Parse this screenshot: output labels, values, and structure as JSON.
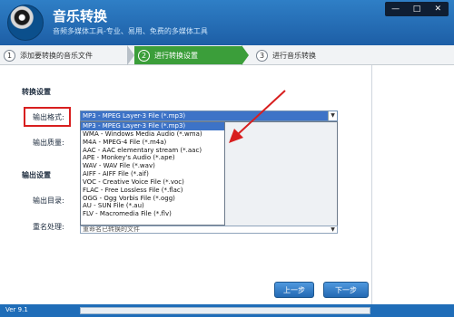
{
  "app": {
    "title": "音乐转换",
    "subtitle": "音频多媒体工具-专业、易用、免费的多媒体工具",
    "window_buttons": [
      "—",
      "□",
      "✕"
    ]
  },
  "steps": [
    {
      "num": "1",
      "label": "添加要转换的音乐文件"
    },
    {
      "num": "2",
      "label": "进行转换设置"
    },
    {
      "num": "3",
      "label": "进行音乐转换"
    }
  ],
  "settings": {
    "conversion_section": "转换设置",
    "format_label": "输出格式:",
    "quality_label": "输出质量:",
    "output_section": "输出设置",
    "dir_label": "输出目录:",
    "rename_label": "重名处理:",
    "rename_value": "重命名已转换的文件"
  },
  "format_select": {
    "selected": "MP3 - MPEG Layer-3 File (*.mp3)",
    "options": [
      "MP3 - MPEG Layer-3 File (*.mp3)",
      "WMA - Windows Media Audio (*.wma)",
      "M4A - MPEG-4 File (*.m4a)",
      "AAC - AAC elementary stream (*.aac)",
      "APE - Monkey's Audio (*.ape)",
      "WAV - WAV File (*.wav)",
      "AIFF - AIFF File (*.aif)",
      "VOC - Creative Voice File (*.voc)",
      "FLAC - Free Lossless File (*.flac)",
      "OGG - Ogg Vorbis File (*.ogg)",
      "AU - SUN File (*.au)",
      "FLV - Macromedia File (*.flv)"
    ]
  },
  "buttons": {
    "prev": "上一步",
    "next": "下一步"
  },
  "status": {
    "version": "Ver 9.1"
  },
  "colors": {
    "accent": "#1f6db8",
    "highlight": "#d81f1f",
    "active_step": "#3b9e3a"
  }
}
